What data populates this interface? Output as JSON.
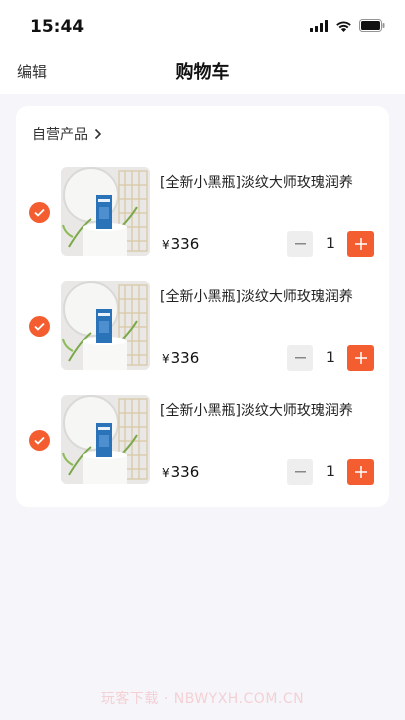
{
  "status_bar": {
    "time": "15:44"
  },
  "nav": {
    "edit_label": "编辑",
    "title": "购物车"
  },
  "store": {
    "name": "自营产品"
  },
  "items": [
    {
      "title": "[全新小黑瓶]淡纹大师玫瑰润养",
      "price_symbol": "¥",
      "price": "336",
      "quantity": "1",
      "checked": true
    },
    {
      "title": "[全新小黑瓶]淡纹大师玫瑰润养",
      "price_symbol": "¥",
      "price": "336",
      "quantity": "1",
      "checked": true
    },
    {
      "title": "[全新小黑瓶]淡纹大师玫瑰润养",
      "price_symbol": "¥",
      "price": "336",
      "quantity": "1",
      "checked": true
    }
  ],
  "watermark": "玩客下载 · NBWYXH.COM.CN",
  "colors": {
    "accent": "#f45d2f",
    "background": "#f5f5fa",
    "card": "#ffffff"
  },
  "icons": {
    "signal": "cellular-signal-icon",
    "wifi": "wifi-icon",
    "battery": "battery-icon",
    "chevron": "chevron-right-icon",
    "check": "check-icon",
    "minus": "minus-icon",
    "plus": "plus-icon"
  }
}
